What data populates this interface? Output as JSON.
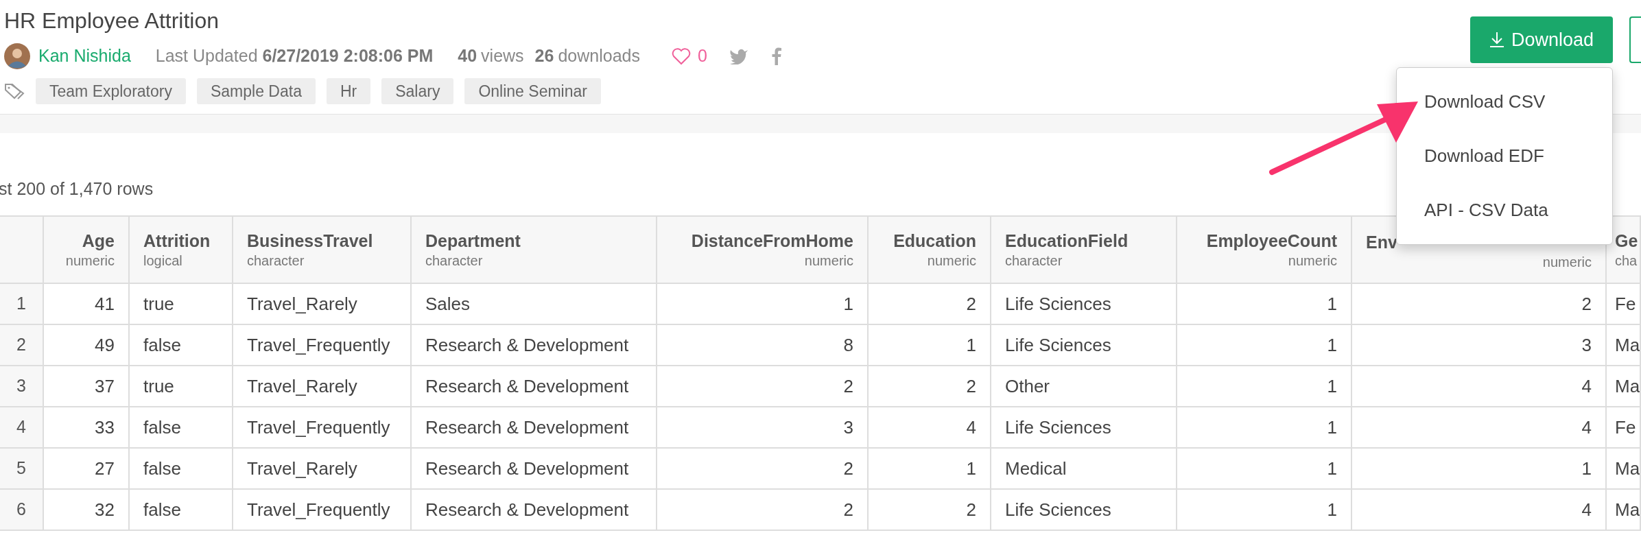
{
  "title": "HR Employee Attrition",
  "author": {
    "name": "Kan Nishida"
  },
  "last_updated": {
    "label": "Last Updated",
    "value": "6/27/2019 2:08:06 PM"
  },
  "views": {
    "count": "40",
    "label": "views"
  },
  "downloads": {
    "count": "26",
    "label": "downloads"
  },
  "likes": {
    "count": "0"
  },
  "tags": [
    "Team Exploratory",
    "Sample Data",
    "Hr",
    "Salary",
    "Online Seminar"
  ],
  "download_button": {
    "label": "Download"
  },
  "download_menu": {
    "items": [
      "Download CSV",
      "Download EDF",
      "API - CSV Data"
    ]
  },
  "row_summary": "st 200 of 1,470 rows",
  "table": {
    "columns": [
      {
        "name": "Age",
        "type": "numeric",
        "kind": "number"
      },
      {
        "name": "Attrition",
        "type": "logical",
        "kind": "text"
      },
      {
        "name": "BusinessTravel",
        "type": "character",
        "kind": "text"
      },
      {
        "name": "Department",
        "type": "character",
        "kind": "text"
      },
      {
        "name": "DistanceFromHome",
        "type": "numeric",
        "kind": "number"
      },
      {
        "name": "Education",
        "type": "numeric",
        "kind": "number"
      },
      {
        "name": "EducationField",
        "type": "character",
        "kind": "text"
      },
      {
        "name": "EmployeeCount",
        "type": "numeric",
        "kind": "number"
      },
      {
        "name": "Env",
        "type": "numeric",
        "kind": "number"
      },
      {
        "name": "Ge",
        "type": "cha",
        "kind": "text"
      }
    ],
    "rows": [
      {
        "number": "1",
        "cells": [
          "41",
          "true",
          "Travel_Rarely",
          "Sales",
          "1",
          "2",
          "Life Sciences",
          "1",
          "2",
          "Fe"
        ]
      },
      {
        "number": "2",
        "cells": [
          "49",
          "false",
          "Travel_Frequently",
          "Research & Development",
          "8",
          "1",
          "Life Sciences",
          "1",
          "3",
          "Ma"
        ]
      },
      {
        "number": "3",
        "cells": [
          "37",
          "true",
          "Travel_Rarely",
          "Research & Development",
          "2",
          "2",
          "Other",
          "1",
          "4",
          "Ma"
        ]
      },
      {
        "number": "4",
        "cells": [
          "33",
          "false",
          "Travel_Frequently",
          "Research & Development",
          "3",
          "4",
          "Life Sciences",
          "1",
          "4",
          "Fe"
        ]
      },
      {
        "number": "5",
        "cells": [
          "27",
          "false",
          "Travel_Rarely",
          "Research & Development",
          "2",
          "1",
          "Medical",
          "1",
          "1",
          "Ma"
        ]
      },
      {
        "number": "6",
        "cells": [
          "32",
          "false",
          "Travel_Frequently",
          "Research & Development",
          "2",
          "2",
          "Life Sciences",
          "1",
          "4",
          "Ma"
        ]
      }
    ]
  }
}
